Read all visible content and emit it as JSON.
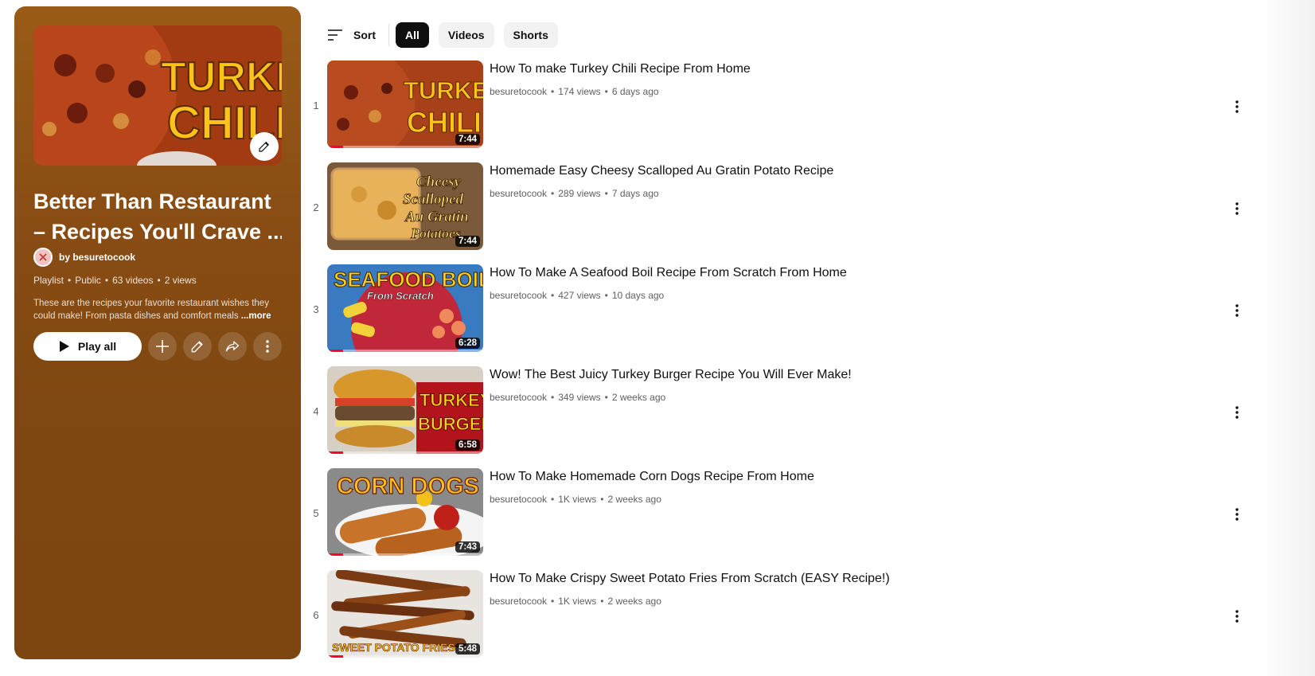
{
  "playlist": {
    "title_line1": "Better Than Restaurant",
    "title_line2": "– Recipes You'll Crave ...",
    "owner": "by besuretocook",
    "meta": [
      "Playlist",
      "Public",
      "63 videos",
      "2 views"
    ],
    "meta_sep": "•",
    "description": "These are the recipes your favorite restaurant wishes they could make! From pasta dishes and comfort meals",
    "more_label": "...more",
    "play_all_label": "Play all",
    "cover_text_line1": "TURKEY",
    "cover_text_line2": "CHILI"
  },
  "toolbar": {
    "sort_label": "Sort",
    "chips": [
      {
        "label": "All",
        "active": true
      },
      {
        "label": "Videos",
        "active": false
      },
      {
        "label": "Shorts",
        "active": false
      }
    ]
  },
  "videos": [
    {
      "index": "1",
      "title": "How To make Turkey Chili Recipe From Home",
      "channel": "besuretocook",
      "views": "174 views",
      "age": "6 days ago",
      "duration": "7:44",
      "thumb_text": "TURKEY CHILI",
      "watched_fraction": 0.1
    },
    {
      "index": "2",
      "title": "Homemade Easy Cheesy Scalloped Au Gratin Potato Recipe",
      "channel": "besuretocook",
      "views": "289 views",
      "age": "7 days ago",
      "duration": "7:44",
      "thumb_text": "Cheesy Scalloped Au Gratin Potatoes",
      "watched_fraction": 0
    },
    {
      "index": "3",
      "title": "How To Make A Seafood Boil Recipe From Scratch From Home",
      "channel": "besuretocook",
      "views": "427 views",
      "age": "10 days ago",
      "duration": "6:28",
      "thumb_text": "SEAFOOD BOIL From Scratch",
      "watched_fraction": 0.1
    },
    {
      "index": "4",
      "title": "Wow! The Best Juicy Turkey Burger Recipe You Will Ever Make!",
      "channel": "besuretocook",
      "views": "349 views",
      "age": "2 weeks ago",
      "duration": "6:58",
      "thumb_text": "TURKEY BURGER",
      "watched_fraction": 0.1
    },
    {
      "index": "5",
      "title": "How To Make Homemade Corn Dogs Recipe From Home",
      "channel": "besuretocook",
      "views": "1K views",
      "age": "2 weeks ago",
      "duration": "7:43",
      "thumb_text": "CORN DOGS",
      "watched_fraction": 0.1
    },
    {
      "index": "6",
      "title": "How To Make Crispy Sweet Potato Fries From Scratch (EASY Recipe!)",
      "channel": "besuretocook",
      "views": "1K views",
      "age": "2 weeks ago",
      "duration": "5:48",
      "thumb_text": "SWEET POTATO FRIES",
      "watched_fraction": 0.1
    }
  ],
  "meta_sep": "•",
  "colors": {
    "panel": "#8a4e14",
    "progress": "#ff0033",
    "chip_active": "#0f0f0f"
  }
}
